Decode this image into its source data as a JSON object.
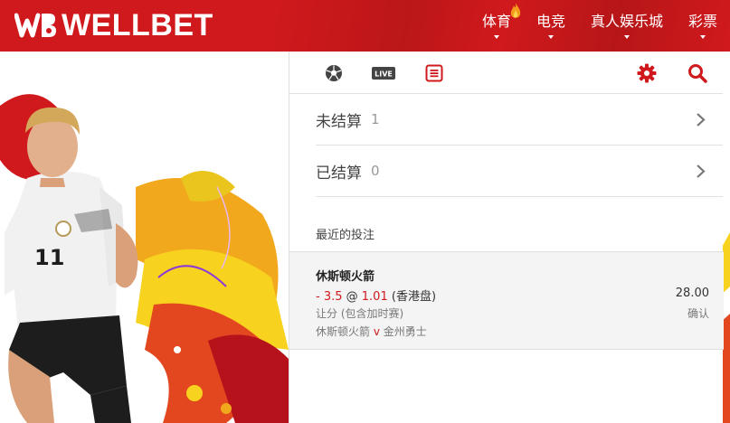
{
  "brand": {
    "name": "WELLBET",
    "color": "#d0191c"
  },
  "nav": {
    "items": [
      {
        "label": "体育",
        "hot": true
      },
      {
        "label": "电竞",
        "hot": false
      },
      {
        "label": "真人娱乐城",
        "hot": false
      },
      {
        "label": "彩票",
        "hot": false
      }
    ]
  },
  "toolbar": {
    "left_icons": [
      "soccer-ball-icon",
      "live-icon",
      "betslip-icon"
    ],
    "live_label": "LIVE",
    "right_icons": [
      "settings-gear-icon",
      "search-icon"
    ],
    "active": "betslip-icon"
  },
  "unsettled": {
    "label": "未结算",
    "count": "1"
  },
  "settled": {
    "label": "已结算",
    "count": "0"
  },
  "recent": {
    "title": "最近的投注",
    "bet": {
      "team": "休斯顿火箭",
      "handicap": "- 3.5",
      "at": "@",
      "odds": "1.01",
      "odds_type": "(香港盘)",
      "stake": "28.00",
      "market": "让分 (包含加时赛)",
      "status": "确认",
      "home": "休斯顿火箭",
      "vs": "v",
      "away": "金州勇士"
    }
  }
}
